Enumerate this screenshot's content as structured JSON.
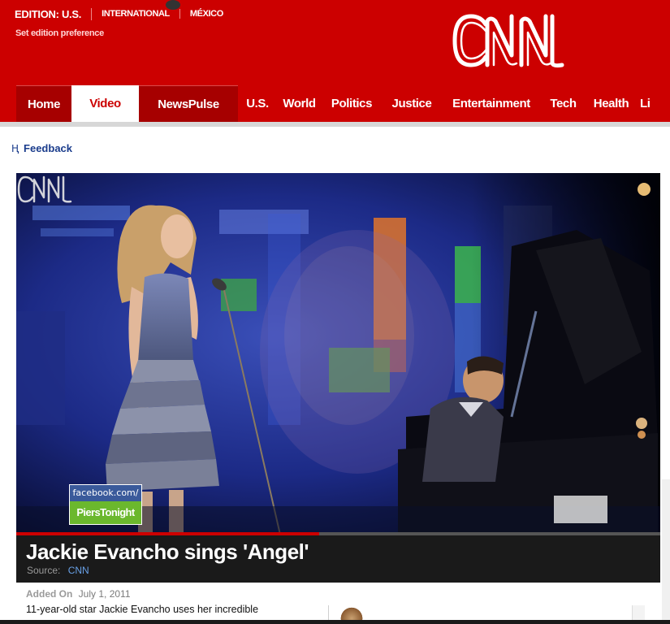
{
  "header": {
    "edition_label": "EDITION: U.S.",
    "edition_links": [
      "INTERNATIONAL",
      "MÉXICO"
    ],
    "edition_pref": "Set edition preference",
    "logo_text": "CNN",
    "brand_color": "#cc0000"
  },
  "nav": {
    "items": [
      {
        "label": "Home",
        "state": "tabbed"
      },
      {
        "label": "Video",
        "state": "active"
      },
      {
        "label": "NewsPulse",
        "state": "tabbed"
      },
      {
        "label": "U.S.",
        "state": "normal"
      },
      {
        "label": "World",
        "state": "normal"
      },
      {
        "label": "Politics",
        "state": "normal"
      },
      {
        "label": "Justice",
        "state": "normal"
      },
      {
        "label": "Entertainment",
        "state": "normal"
      },
      {
        "label": "Tech",
        "state": "normal"
      },
      {
        "label": "Health",
        "state": "normal"
      },
      {
        "label": "Li",
        "state": "normal"
      }
    ]
  },
  "feedback": {
    "label": "Feedback",
    "icon": "feedback-icon"
  },
  "player": {
    "fb_badge_top": "facebook.com/",
    "fb_badge_bottom": "PiersTonight",
    "watermark": "CNN",
    "progress_fraction": 0.47
  },
  "video": {
    "title": "Jackie Evancho sings 'Angel'",
    "source_label": "Source:",
    "source_value": "CNN",
    "added_label": "Added On",
    "added_date": "July 1, 2011",
    "description": "11-year-old star Jackie Evancho uses her incredible"
  }
}
